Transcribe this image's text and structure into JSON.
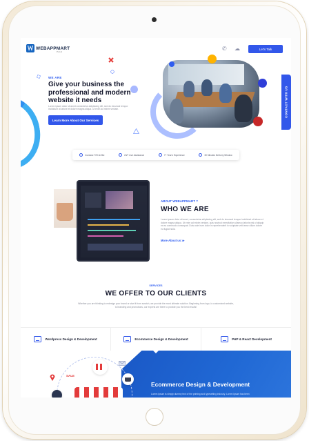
{
  "header": {
    "logo_text": "WEBAPPMART",
    "logo_sub": "Pvt Ltd",
    "cta_label": "Let's Talk"
  },
  "hero": {
    "eyebrow": "WE ARE",
    "title": "Give your business the professional and modern website it needs",
    "text": "Lorem ipsum dolor sit amet consectetur adipisicing elit, sed do eiusmod tempor incididunt ut labore et dolore magna aliqua. Ut enim ad minim veniam.",
    "button_label": "Learn More About Our Services"
  },
  "contact_tab_label": "CONTACT WITH US",
  "stats": [
    {
      "label": "Increase 70% in Biz",
      "icon": "chart-icon"
    },
    {
      "label": "24/7 Live Assistance",
      "icon": "headset-icon"
    },
    {
      "label": "7+ Year's Experience",
      "icon": "award-icon"
    },
    {
      "label": "30 Minutes Delivery Window",
      "icon": "clock-icon"
    }
  ],
  "about": {
    "eyebrow": "ABOUT WEBAPPMART ?",
    "title": "WHO WE ARE",
    "text": "Lorem ipsum dolor sit amet, consectetur adipisicing elit, sed do eiusmod tempor incididunt ut labore et dolore magna aliqua. Ut enim ad minim veniam, quis nostrud exercitation ullamco laboris nisi ut aliquip ex ea commodo consequat. Duis aute irure dolor in reprehenderit in voluptate velit esse cillum dolore eu fugiat nulla.",
    "link_label": "More About us ≫"
  },
  "services": {
    "eyebrow": "SERVICES",
    "title": "WE OFFER TO OUR CLIENTS",
    "text": "Whether you are thinking to redesign your brand or start it from scratch, we provide the most ultimate solution. Beginning from logo, to customized website, to branding and promotions, our experts are there to provide you the best results!",
    "tabs": [
      {
        "label": "Wordpress Design & Development",
        "active": false
      },
      {
        "label": "Ecommerce Design & Development",
        "active": true
      },
      {
        "label": "PHP & React Development",
        "active": false
      }
    ],
    "panel_title": "Ecommerce Design & Development",
    "panel_text": "Lorem Ipsum is simply dummy text of the printing and typesetting industry. Lorem Ipsum has been",
    "sale_label": "SALE"
  },
  "colors": {
    "accent": "#3257ea",
    "text_dark": "#13162b",
    "panel_blue": "#1a58c6"
  }
}
